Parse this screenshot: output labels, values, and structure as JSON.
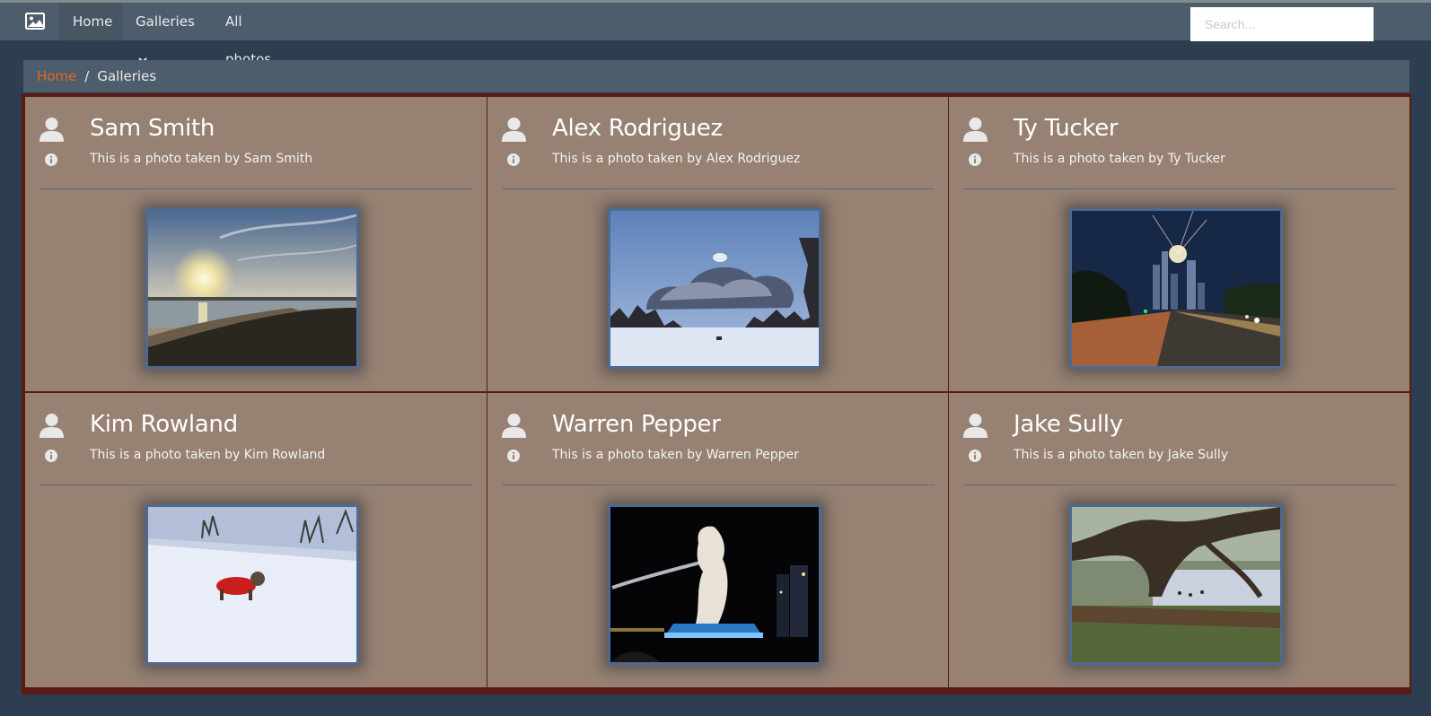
{
  "nav": {
    "brand_icon": "image-icon",
    "home": "Home",
    "galleries": "Galleries",
    "all_photos": "All photos",
    "search_placeholder": "Search..."
  },
  "breadcrumb": {
    "home": "Home",
    "separator": "/",
    "current": "Galleries"
  },
  "colors": {
    "accent": "#df691a",
    "background": "#2c3e50",
    "navbar": "#4e5d6c",
    "card": "#968172",
    "card_border": "#5a1b14"
  },
  "galleries": [
    {
      "name": "Sam Smith",
      "description": "This is a photo taken by Sam Smith",
      "photo": "sunset over water"
    },
    {
      "name": "Alex Rodriguez",
      "description": "This is a photo taken by Alex Rodriguez",
      "photo": "snowy field with clouds"
    },
    {
      "name": "Ty Tucker",
      "description": "This is a photo taken by Ty Tucker",
      "photo": "city street at night"
    },
    {
      "name": "Kim Rowland",
      "description": "This is a photo taken by Kim Rowland",
      "photo": "dog in red coat on snow"
    },
    {
      "name": "Warren Pepper",
      "description": "This is a photo taken by Warren Pepper",
      "photo": "merlion statue at night"
    },
    {
      "name": "Jake Sully",
      "description": "This is a photo taken by Jake Sully",
      "photo": "old tree by a pond"
    }
  ]
}
